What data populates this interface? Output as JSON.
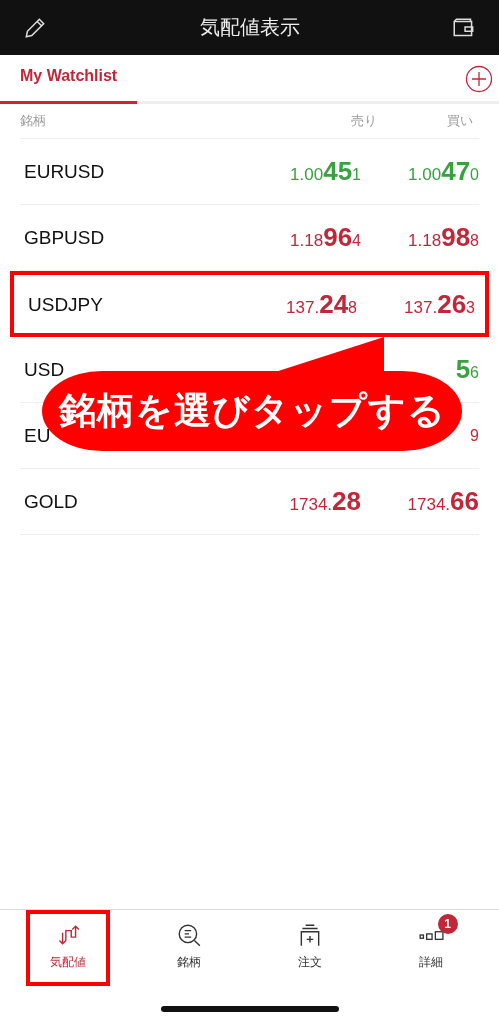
{
  "header": {
    "title": "気配値表示"
  },
  "tabs": [
    {
      "label": "My Watchlist",
      "selected": true
    }
  ],
  "columns": {
    "symbol": "銘柄",
    "bid": "売り",
    "ask": "買い"
  },
  "rows": [
    {
      "name": "EURUSD",
      "rising": true,
      "highlighted": false,
      "bid": {
        "head": "1.00",
        "big": "45",
        "tail": "1"
      },
      "ask": {
        "head": "1.00",
        "big": "47",
        "tail": "0"
      }
    },
    {
      "name": "GBPUSD",
      "rising": false,
      "highlighted": false,
      "bid": {
        "head": "1.18",
        "big": "96",
        "tail": "4"
      },
      "ask": {
        "head": "1.18",
        "big": "98",
        "tail": "8"
      }
    },
    {
      "name": "USDJPY",
      "rising": false,
      "highlighted": true,
      "bid": {
        "head": "137.",
        "big": "24",
        "tail": "8"
      },
      "ask": {
        "head": "137.",
        "big": "26",
        "tail": "3"
      }
    },
    {
      "name": "USD",
      "rising": true,
      "highlighted": false,
      "ask": {
        "big": "5",
        "tail": "6"
      }
    },
    {
      "name": "EU",
      "rising": false,
      "highlighted": false,
      "ask": {
        "tail": "9"
      }
    },
    {
      "name": "GOLD",
      "rising": false,
      "highlighted": false,
      "bid": {
        "head": "1734.",
        "big": "28"
      },
      "ask": {
        "head": "1734.",
        "big": "66"
      }
    }
  ],
  "callout": {
    "text": "銘柄を選びタップする"
  },
  "nav": [
    {
      "label": "気配値",
      "selected": true
    },
    {
      "label": "銘柄",
      "selected": false
    },
    {
      "label": "注文",
      "selected": false
    },
    {
      "label": "詳細",
      "selected": false,
      "badge": "1"
    }
  ]
}
